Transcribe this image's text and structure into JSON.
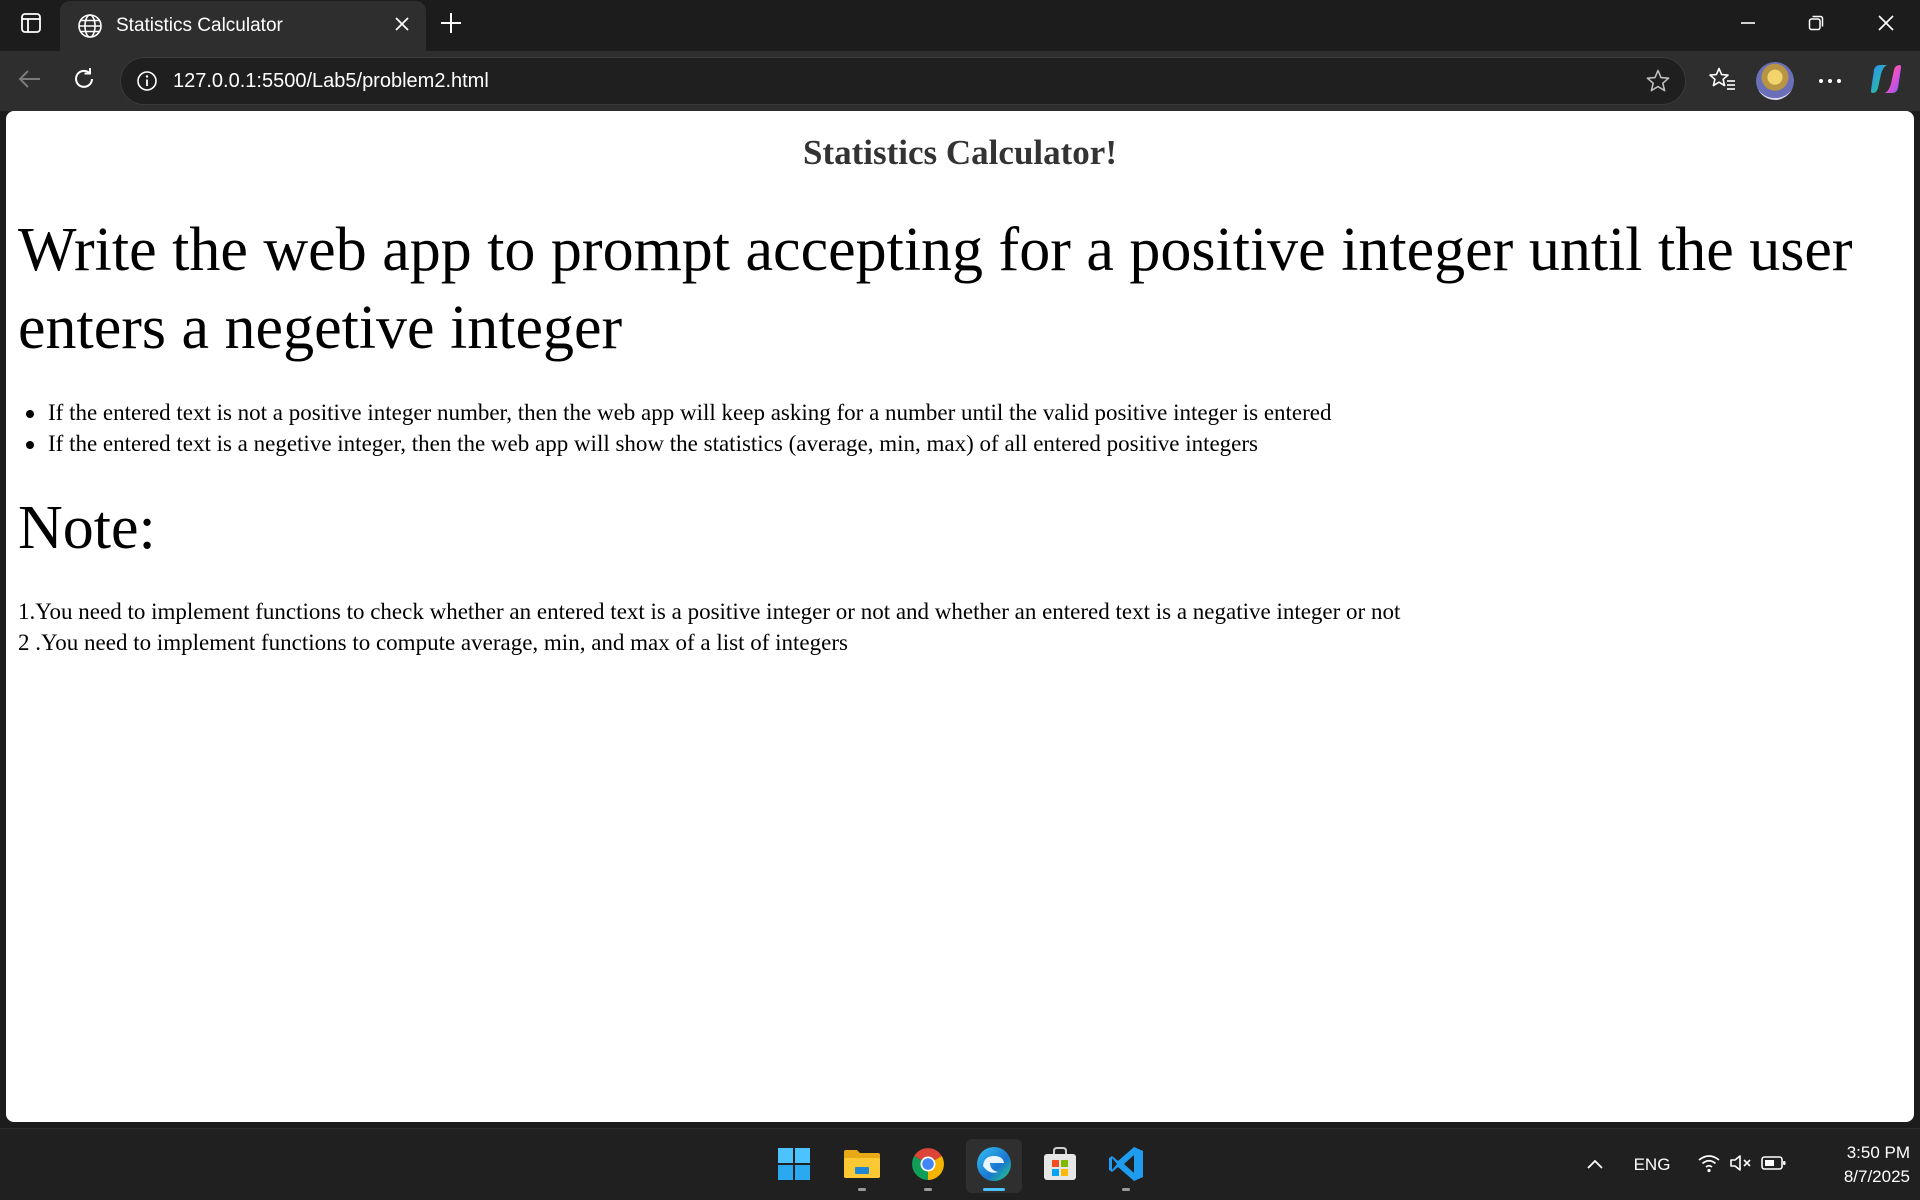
{
  "browser": {
    "tab_title": "Statistics Calculator",
    "url": "127.0.0.1:5500/Lab5/problem2.html"
  },
  "page": {
    "title": "Statistics Calculator!",
    "heading": "Write the web app to prompt accepting for a positive integer until the user enters a negetive integer",
    "rules": [
      "If the entered text is not a positive integer number, then the web app will keep asking for a number until the valid positive integer is entered",
      "If the entered text is a negetive integer, then the web app will show the statistics (average, min, max) of all entered positive integers"
    ],
    "note_heading": "Note:",
    "notes": [
      "1.You need to implement functions to check whether an entered text is a positive integer or not and whether an entered text is a negative integer or not",
      "2 .You need to implement functions to compute average, min, and max of a list of integers"
    ]
  },
  "taskbar": {
    "apps": [
      "start-icon",
      "file-explorer-icon",
      "chrome-icon",
      "edge-icon",
      "microsoft-store-icon",
      "vscode-icon"
    ],
    "language": "ENG",
    "time": "3:50 PM",
    "date": "8/7/2025"
  },
  "colors": {
    "accent": "#4cc2ff",
    "chrome_bg": "#1c1c1c",
    "toolbar_bg": "#2e2e2e",
    "heading_text": "#333333"
  }
}
